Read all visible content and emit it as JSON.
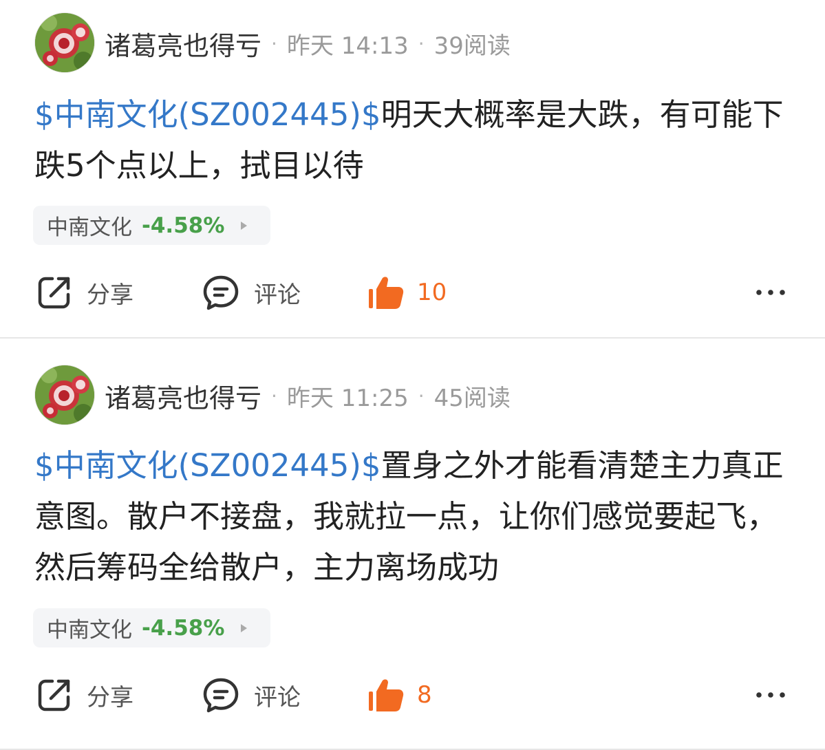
{
  "posts": [
    {
      "author": "诸葛亮也得亏",
      "time": "昨天 14:13",
      "reads": "39阅读",
      "stock_tag": "$中南文化(SZ002445)$",
      "text": "明天大概率是大跌，有可能下跌5个点以上，拭目以待",
      "chip": {
        "name": "中南文化",
        "change": "-4.58%"
      },
      "actions": {
        "share": "分享",
        "comment": "评论",
        "likes": "10"
      }
    },
    {
      "author": "诸葛亮也得亏",
      "time": "昨天 11:25",
      "reads": "45阅读",
      "stock_tag": "$中南文化(SZ002445)$",
      "text": "置身之外才能看清楚主力真正意图。散户不接盘，我就拉一点，让你们感觉要起飞，然后筹码全给散户，主力离场成功",
      "chip": {
        "name": "中南文化",
        "change": "-4.58%"
      },
      "actions": {
        "share": "分享",
        "comment": "评论",
        "likes": "8"
      }
    }
  ],
  "separator": "·",
  "colors": {
    "link": "#3478c8",
    "down": "#48a04a",
    "like": "#f26a21",
    "divider": "#e6e6e6"
  },
  "icons": [
    "share-icon",
    "comment-icon",
    "thumbs-up-icon",
    "more-icon",
    "chip-arrow-icon"
  ]
}
